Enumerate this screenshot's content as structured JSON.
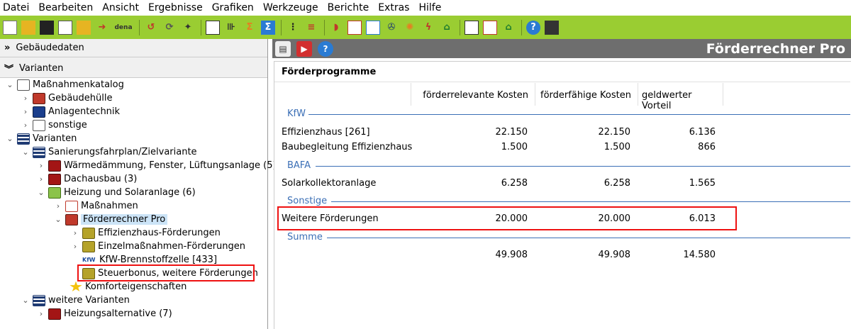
{
  "menu": [
    "Datei",
    "Bearbeiten",
    "Ansicht",
    "Ergebnisse",
    "Grafiken",
    "Werkzeuge",
    "Berichte",
    "Extras",
    "Hilfe"
  ],
  "toolbar": {
    "dena_label": "dena",
    "icons": [
      "new-file-icon",
      "open-folder-icon",
      "save-icon",
      "copy-icon",
      "import-icon",
      "export-icon",
      "undo-icon",
      "refresh-icon",
      "wizard-icon",
      "list-icon",
      "split-icon",
      "sum-icon",
      "sum-blue-icon",
      "tree-icon",
      "columns-icon",
      "heating-icon",
      "window-icon",
      "door-icon",
      "fan-icon",
      "sun-icon",
      "lightning-icon",
      "house-icon",
      "report-icon",
      "chart-icon",
      "roof-icon",
      "help-icon",
      "calculator-icon"
    ]
  },
  "left": {
    "gebaeudedaten": "Gebäudedaten",
    "varianten_header": "Varianten",
    "tree": [
      {
        "label": "Maßnahmenkatalog",
        "icon": "book-icon",
        "exp": "v"
      },
      {
        "label": "Gebäudehülle",
        "icon": "house-icon",
        "exp": ">"
      },
      {
        "label": "Anlagentechnik",
        "icon": "plant-icon",
        "exp": ">"
      },
      {
        "label": "sonstige",
        "icon": "book-icon",
        "exp": ">"
      },
      {
        "label": "Varianten",
        "icon": "grid-icon",
        "exp": "v"
      },
      {
        "label": "Sanierungsfahrplan/Zielvariante",
        "icon": "grid-icon",
        "exp": "v"
      },
      {
        "label": "Wärmedämmung, Fenster, Lüftungsanlage (5)",
        "icon": "box-red-icon",
        "exp": ">"
      },
      {
        "label": "Dachausbau (3)",
        "icon": "box-red-icon",
        "exp": ">"
      },
      {
        "label": "Heizung und Solaranlage (6)",
        "icon": "box-green-icon",
        "exp": "v"
      },
      {
        "label": "Maßnahmen",
        "icon": "checklist-icon",
        "exp": ">"
      },
      {
        "label": "Förderrechner Pro",
        "icon": "calculator-icon",
        "exp": "v"
      },
      {
        "label": "Effizienzhaus-Förderungen",
        "icon": "coin-icon",
        "exp": ">"
      },
      {
        "label": "Einzelmaßnahmen-Förderungen",
        "icon": "coin-icon",
        "exp": ">"
      },
      {
        "label": "KfW-Brennstoffzelle [433]",
        "icon": "kfw-icon",
        "exp": ""
      },
      {
        "label": "Steuerbonus, weitere Förderungen",
        "icon": "coin-icon",
        "exp": ""
      },
      {
        "label": "Komforteigenschaften",
        "icon": "star-icon",
        "exp": ""
      },
      {
        "label": "weitere Varianten",
        "icon": "grid-icon",
        "exp": "v"
      },
      {
        "label": "Heizungsalternative (7)",
        "icon": "box-red-icon",
        "exp": ">"
      }
    ],
    "kfw_tag": "KfW"
  },
  "right": {
    "title": "Förderrechner Pro",
    "section_title": "Förderprogramme",
    "columns": [
      "förderrelevante Kosten",
      "förderfähige Kosten",
      "geldwerter Vorteil"
    ],
    "groups": [
      {
        "name": "KfW",
        "rows": [
          {
            "label": "Effizienzhaus [261]",
            "values": [
              "22.150",
              "22.150",
              "6.136"
            ]
          },
          {
            "label": "Baubegleitung Effizienzhaus",
            "values": [
              "1.500",
              "1.500",
              "866"
            ]
          }
        ]
      },
      {
        "name": "BAFA",
        "rows": [
          {
            "label": "Solarkollektoranlage",
            "values": [
              "6.258",
              "6.258",
              "1.565"
            ]
          }
        ]
      },
      {
        "name": "Sonstige",
        "rows": [
          {
            "label": "Weitere Förderungen",
            "values": [
              "20.000",
              "20.000",
              "6.013"
            ]
          }
        ]
      },
      {
        "name": "Summe",
        "rows": [
          {
            "label": "",
            "values": [
              "49.908",
              "49.908",
              "14.580"
            ]
          }
        ]
      }
    ]
  }
}
